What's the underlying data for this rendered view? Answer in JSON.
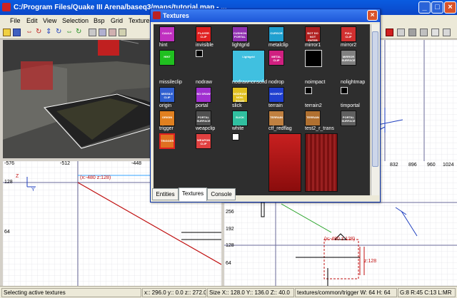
{
  "window": {
    "title": "C:/Program Files/Quake III Arena/baseq3/maps/tutorial.map - ..."
  },
  "menu": [
    "File",
    "Edit",
    "View",
    "Selection",
    "Bsp",
    "Grid",
    "Textures"
  ],
  "xy_view": {
    "top_ruler": [
      "-576",
      "-512",
      "-448"
    ],
    "left_ruler": [
      "128",
      "64"
    ],
    "axis_label_z": "Z",
    "axis_label_y": "Y",
    "point_label": "(x:-480  z:128)"
  },
  "right_view": {
    "top_ruler": [
      "832",
      "896",
      "960",
      "1024"
    ],
    "left_ruler": [
      "256",
      "192",
      "128",
      "64"
    ],
    "point_label_1": "(x:-480  z:128)",
    "point_label_2": "z:128"
  },
  "textures_window": {
    "title": "Textures",
    "tiles": [
      {
        "label": "",
        "text": "CAULK",
        "color": "#c030c0"
      },
      {
        "label": "",
        "text": "PLAYER CLIP",
        "color": "#e02020"
      },
      {
        "label": "",
        "text": "CUSHION PORTAL",
        "color": "#9030b0"
      },
      {
        "label": "",
        "text": "CURSOR",
        "color": "#20a0d0"
      },
      {
        "label": "",
        "text": "BOT DO NOT ENTER",
        "color": "#b02020"
      },
      {
        "label": "",
        "text": "FULL CLIP",
        "color": "#d03030"
      },
      {
        "label": "hint",
        "text": "HINT",
        "color": "#20c020"
      },
      {
        "label": "invisible",
        "text": "",
        "color": "#000000"
      },
      {
        "label": "lightgrid",
        "text": "Lightgrid",
        "color": "#40c0e0"
      },
      {
        "label": "metalclip",
        "text": "METAL CLIP",
        "color": "#d02080"
      },
      {
        "label": "mirror1",
        "text": "",
        "color": "#000000"
      },
      {
        "label": "mirror2",
        "text": "MIRROR SURFACE",
        "color": "#808080"
      },
      {
        "label": "missileclip",
        "text": "MISSILE CLIP",
        "color": "#3060d0"
      },
      {
        "label": "nodraw",
        "text": "NO DRAW",
        "color": "#a030d0"
      },
      {
        "label": "nodrawnonsolid",
        "text": "NODRAW NON-SOLID",
        "color": "#e0c020"
      },
      {
        "label": "nodrop",
        "text": "NODROP",
        "color": "#2040d0"
      },
      {
        "label": "noimpact",
        "text": "",
        "color": "#000000"
      },
      {
        "label": "nolightmap",
        "text": "",
        "color": "#000000"
      },
      {
        "label": "origin",
        "text": "ORIGIN",
        "color": "#e08020"
      },
      {
        "label": "portal",
        "text": "PORTAL SURFACE",
        "color": "#505050"
      },
      {
        "label": "slick",
        "text": "SLICK",
        "color": "#30c0a0"
      },
      {
        "label": "terrain",
        "text": "TERRAIN",
        "color": "#c08040"
      },
      {
        "label": "terrain2",
        "text": "TERRAIN",
        "color": "#b07030"
      },
      {
        "label": "timportal",
        "text": "PORTAL SURFACE",
        "color": "#606060"
      },
      {
        "label": "trigger",
        "text": "TRIGGER",
        "color": "#e07020"
      },
      {
        "label": "weapclip",
        "text": "WEAPON CLIP",
        "color": "#e04040"
      },
      {
        "label": "white",
        "text": "",
        "color": "#ffffff"
      },
      {
        "label": "ctf_redflag",
        "text": "",
        "color": "#b01818"
      },
      {
        "label": "test2_r_trans",
        "text": "",
        "color": "#7a1010"
      }
    ],
    "tabs": [
      "Entities",
      "Textures",
      "Console"
    ],
    "active_tab": "Textures"
  },
  "status": {
    "message": "Selecting active textures",
    "coords": "x:: 296.0  y:: 0.0  z:: 272.0",
    "size": "Size X:: 128.0  Y:: 136.0  Z:: 40.0",
    "texture": "textures/common/trigger W: 64 H: 64",
    "grid": "G:8 R:45 C:13 L:MR"
  },
  "colors": {
    "accent": "#0a5ce0",
    "selection_red": "#c01010",
    "grid": "#c8c8d8"
  }
}
